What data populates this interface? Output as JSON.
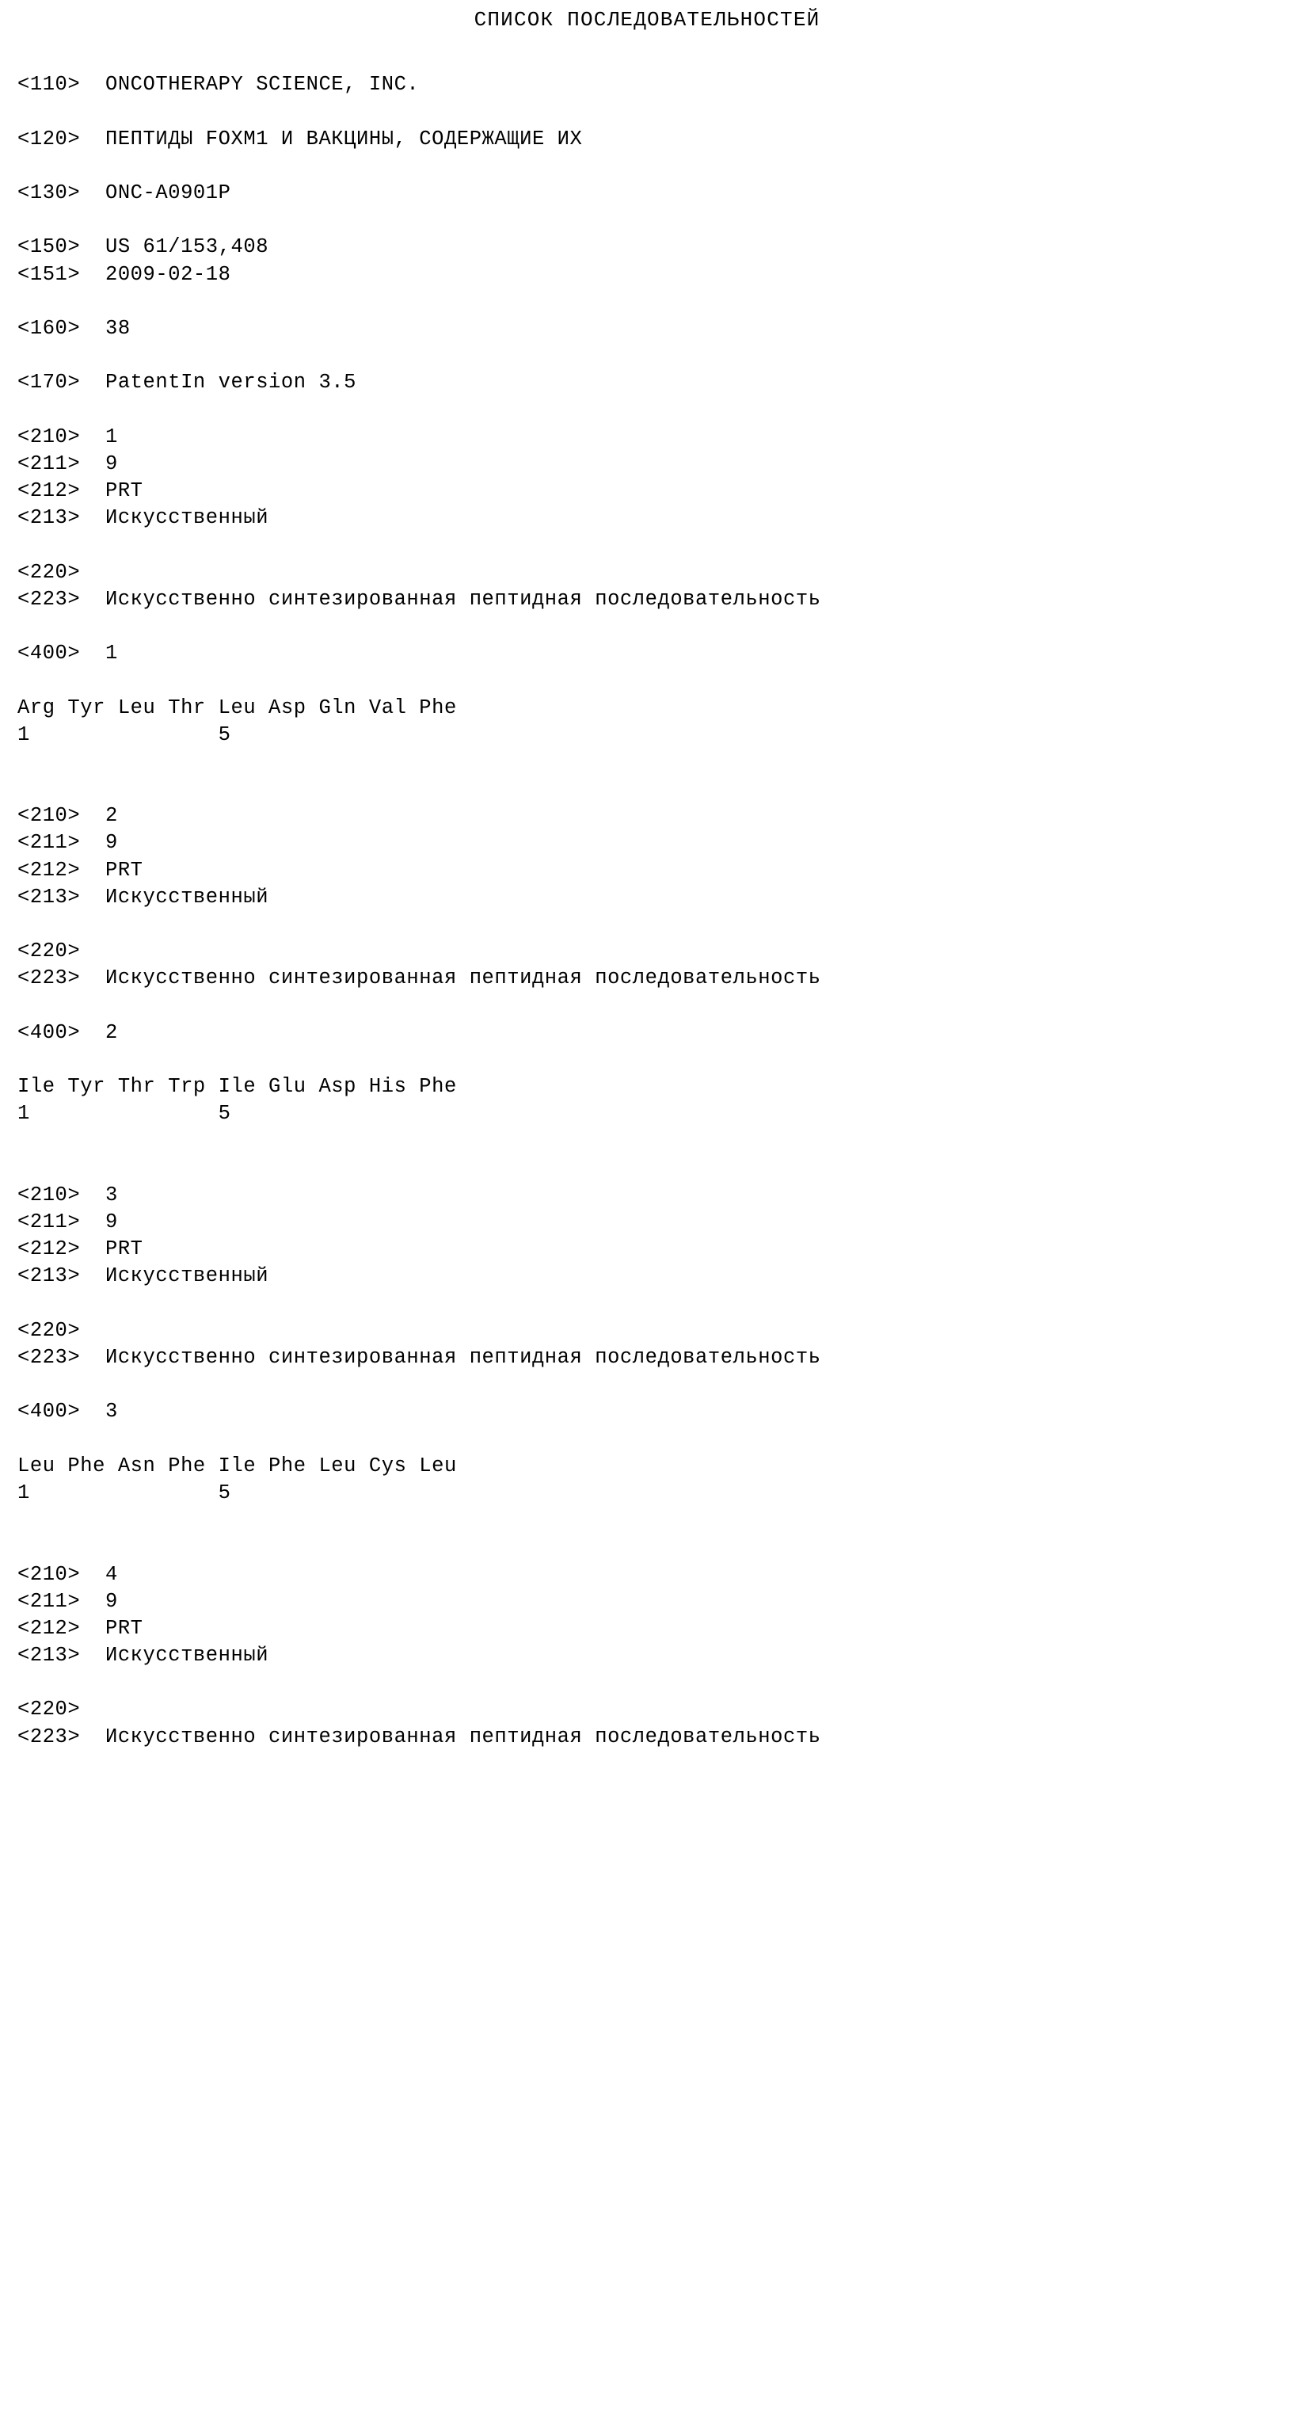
{
  "document": {
    "title": "СПИСОК ПОСЛЕДОВАТЕЛЬНОСТЕЙ",
    "type": "patent-sequence-listing",
    "language": "ru",
    "background_color": "#ffffff",
    "text_color": "#000000"
  },
  "header_fields": [
    {
      "tag": "<110>",
      "value": "ONCOTHERAPY SCIENCE, INC."
    },
    {
      "tag": "<120>",
      "value": "ПЕПТИДЫ FOXM1 И ВАКЦИНЫ, СОДЕРЖАЩИЕ ИХ"
    },
    {
      "tag": "<130>",
      "value": "ONC-A0901P"
    },
    {
      "tag": "<150>",
      "value": "US 61/153,408"
    },
    {
      "tag": "<151>",
      "value": "2009-02-18"
    },
    {
      "tag": "<160>",
      "value": "38"
    },
    {
      "tag": "<170>",
      "value": "PatentIn version 3.5"
    }
  ],
  "labels": {
    "tag_210": "<210>",
    "tag_211": "<211>",
    "tag_212": "<212>",
    "tag_213": "<213>",
    "tag_220": "<220>",
    "tag_223": "<223>",
    "tag_400": "<400>",
    "organism_artificial": "Искусственный",
    "molecule_type_prt": "PRT",
    "other_info": "Искусственно синтезированная пептидная последовательность"
  },
  "sequences": [
    {
      "seq_id": "1",
      "length": "9",
      "molecule_type": "PRT",
      "organism": "Искусственный",
      "other_info": "Искусственно синтезированная пептидная последовательность",
      "residues": [
        "Arg",
        "Tyr",
        "Leu",
        "Thr",
        "Leu",
        "Asp",
        "Gln",
        "Val",
        "Phe"
      ],
      "residue_line": "Arg Tyr Leu Thr Leu Asp Gln Val Phe",
      "number_line": "1               5"
    },
    {
      "seq_id": "2",
      "length": "9",
      "molecule_type": "PRT",
      "organism": "Искусственный",
      "other_info": "Искусственно синтезированная пептидная последовательность",
      "residues": [
        "Ile",
        "Tyr",
        "Thr",
        "Trp",
        "Ile",
        "Glu",
        "Asp",
        "His",
        "Phe"
      ],
      "residue_line": "Ile Tyr Thr Trp Ile Glu Asp His Phe",
      "number_line": "1               5"
    },
    {
      "seq_id": "3",
      "length": "9",
      "molecule_type": "PRT",
      "organism": "Искусственный",
      "other_info": "Искусственно синтезированная пептидная последовательность",
      "residues": [
        "Leu",
        "Phe",
        "Asn",
        "Phe",
        "Ile",
        "Phe",
        "Leu",
        "Cys",
        "Leu"
      ],
      "residue_line": "Leu Phe Asn Phe Ile Phe Leu Cys Leu",
      "number_line": "1               5"
    },
    {
      "seq_id": "4",
      "length": "9",
      "molecule_type": "PRT",
      "organism": "Искусственный",
      "other_info": "Искусственно синтезированная пептидная последовательность",
      "residues": [],
      "residue_line": "",
      "number_line": ""
    }
  ],
  "lines": [
    {
      "kind": "blank",
      "text": ""
    },
    {
      "kind": "field",
      "text": "<110>  ONCOTHERAPY SCIENCE, INC."
    },
    {
      "kind": "blank",
      "text": ""
    },
    {
      "kind": "field",
      "text": "<120>  ПЕПТИДЫ FOXM1 И ВАКЦИНЫ, СОДЕРЖАЩИЕ ИХ"
    },
    {
      "kind": "blank",
      "text": ""
    },
    {
      "kind": "field",
      "text": "<130>  ONC-A0901P"
    },
    {
      "kind": "blank",
      "text": ""
    },
    {
      "kind": "field",
      "text": "<150>  US 61/153,408"
    },
    {
      "kind": "field",
      "text": "<151>  2009-02-18"
    },
    {
      "kind": "blank",
      "text": ""
    },
    {
      "kind": "field",
      "text": "<160>  38"
    },
    {
      "kind": "blank",
      "text": ""
    },
    {
      "kind": "field",
      "text": "<170>  PatentIn version 3.5"
    },
    {
      "kind": "blank",
      "text": ""
    },
    {
      "kind": "field",
      "text": "<210>  1"
    },
    {
      "kind": "field",
      "text": "<211>  9"
    },
    {
      "kind": "field",
      "text": "<212>  PRT"
    },
    {
      "kind": "field",
      "text": "<213>  Искусственный"
    },
    {
      "kind": "blank",
      "text": ""
    },
    {
      "kind": "field",
      "text": "<220>"
    },
    {
      "kind": "field",
      "text": "<223>  Искусственно синтезированная пептидная последовательность"
    },
    {
      "kind": "blank",
      "text": ""
    },
    {
      "kind": "field",
      "text": "<400>  1"
    },
    {
      "kind": "blank",
      "text": ""
    },
    {
      "kind": "seq",
      "text": "Arg Tyr Leu Thr Leu Asp Gln Val Phe"
    },
    {
      "kind": "num",
      "text": "1               5"
    },
    {
      "kind": "blank",
      "text": ""
    },
    {
      "kind": "blank",
      "text": ""
    },
    {
      "kind": "field",
      "text": "<210>  2"
    },
    {
      "kind": "field",
      "text": "<211>  9"
    },
    {
      "kind": "field",
      "text": "<212>  PRT"
    },
    {
      "kind": "field",
      "text": "<213>  Искусственный"
    },
    {
      "kind": "blank",
      "text": ""
    },
    {
      "kind": "field",
      "text": "<220>"
    },
    {
      "kind": "field",
      "text": "<223>  Искусственно синтезированная пептидная последовательность"
    },
    {
      "kind": "blank",
      "text": ""
    },
    {
      "kind": "field",
      "text": "<400>  2"
    },
    {
      "kind": "blank",
      "text": ""
    },
    {
      "kind": "seq",
      "text": "Ile Tyr Thr Trp Ile Glu Asp His Phe"
    },
    {
      "kind": "num",
      "text": "1               5"
    },
    {
      "kind": "blank",
      "text": ""
    },
    {
      "kind": "blank",
      "text": ""
    },
    {
      "kind": "field",
      "text": "<210>  3"
    },
    {
      "kind": "field",
      "text": "<211>  9"
    },
    {
      "kind": "field",
      "text": "<212>  PRT"
    },
    {
      "kind": "field",
      "text": "<213>  Искусственный"
    },
    {
      "kind": "blank",
      "text": ""
    },
    {
      "kind": "field",
      "text": "<220>"
    },
    {
      "kind": "field",
      "text": "<223>  Искусственно синтезированная пептидная последовательность"
    },
    {
      "kind": "blank",
      "text": ""
    },
    {
      "kind": "field",
      "text": "<400>  3"
    },
    {
      "kind": "blank",
      "text": ""
    },
    {
      "kind": "seq",
      "text": "Leu Phe Asn Phe Ile Phe Leu Cys Leu"
    },
    {
      "kind": "num",
      "text": "1               5"
    },
    {
      "kind": "blank",
      "text": ""
    },
    {
      "kind": "blank",
      "text": ""
    },
    {
      "kind": "field",
      "text": "<210>  4"
    },
    {
      "kind": "field",
      "text": "<211>  9"
    },
    {
      "kind": "field",
      "text": "<212>  PRT"
    },
    {
      "kind": "field",
      "text": "<213>  Искусственный"
    },
    {
      "kind": "blank",
      "text": ""
    },
    {
      "kind": "field",
      "text": "<220>"
    },
    {
      "kind": "field",
      "text": "<223>  Искусственно синтезированная пептидная последовательность"
    }
  ]
}
